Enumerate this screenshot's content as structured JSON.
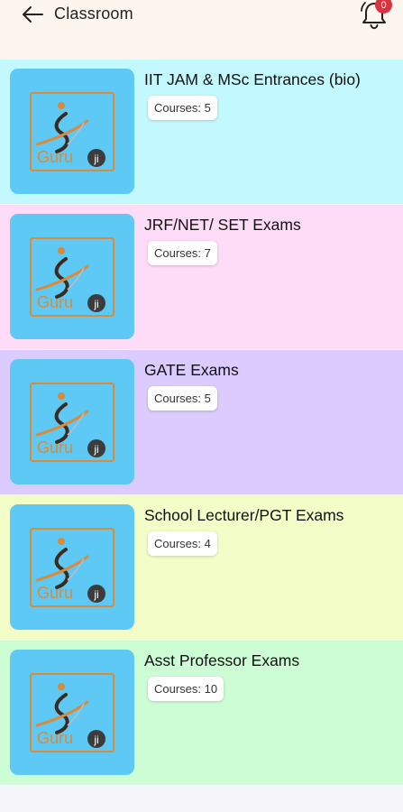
{
  "header": {
    "title": "Classroom",
    "notification_count": "0"
  },
  "logo": {
    "word": "Guru",
    "suffix": "ji"
  },
  "categories": [
    {
      "title": "IIT JAM & MSc Entrances (bio)",
      "courses": "Courses: 5",
      "bg": "#c3f9fe"
    },
    {
      "title": "JRF/NET/ SET Exams",
      "courses": "Courses: 7",
      "bg": "#fedcf7"
    },
    {
      "title": "GATE Exams",
      "courses": "Courses: 5",
      "bg": "#dccbfe"
    },
    {
      "title": "School Lecturer/PGT Exams",
      "courses": "Courses: 4",
      "bg": "#f3fdc8"
    },
    {
      "title": "Asst Professor Exams",
      "courses": "Courses: 10",
      "bg": "#cdfdd4"
    }
  ],
  "colors": {
    "thumb_bg": "#5fc9f5",
    "logo_orange": "#d98a3a",
    "badge_red": "#d9333f"
  }
}
